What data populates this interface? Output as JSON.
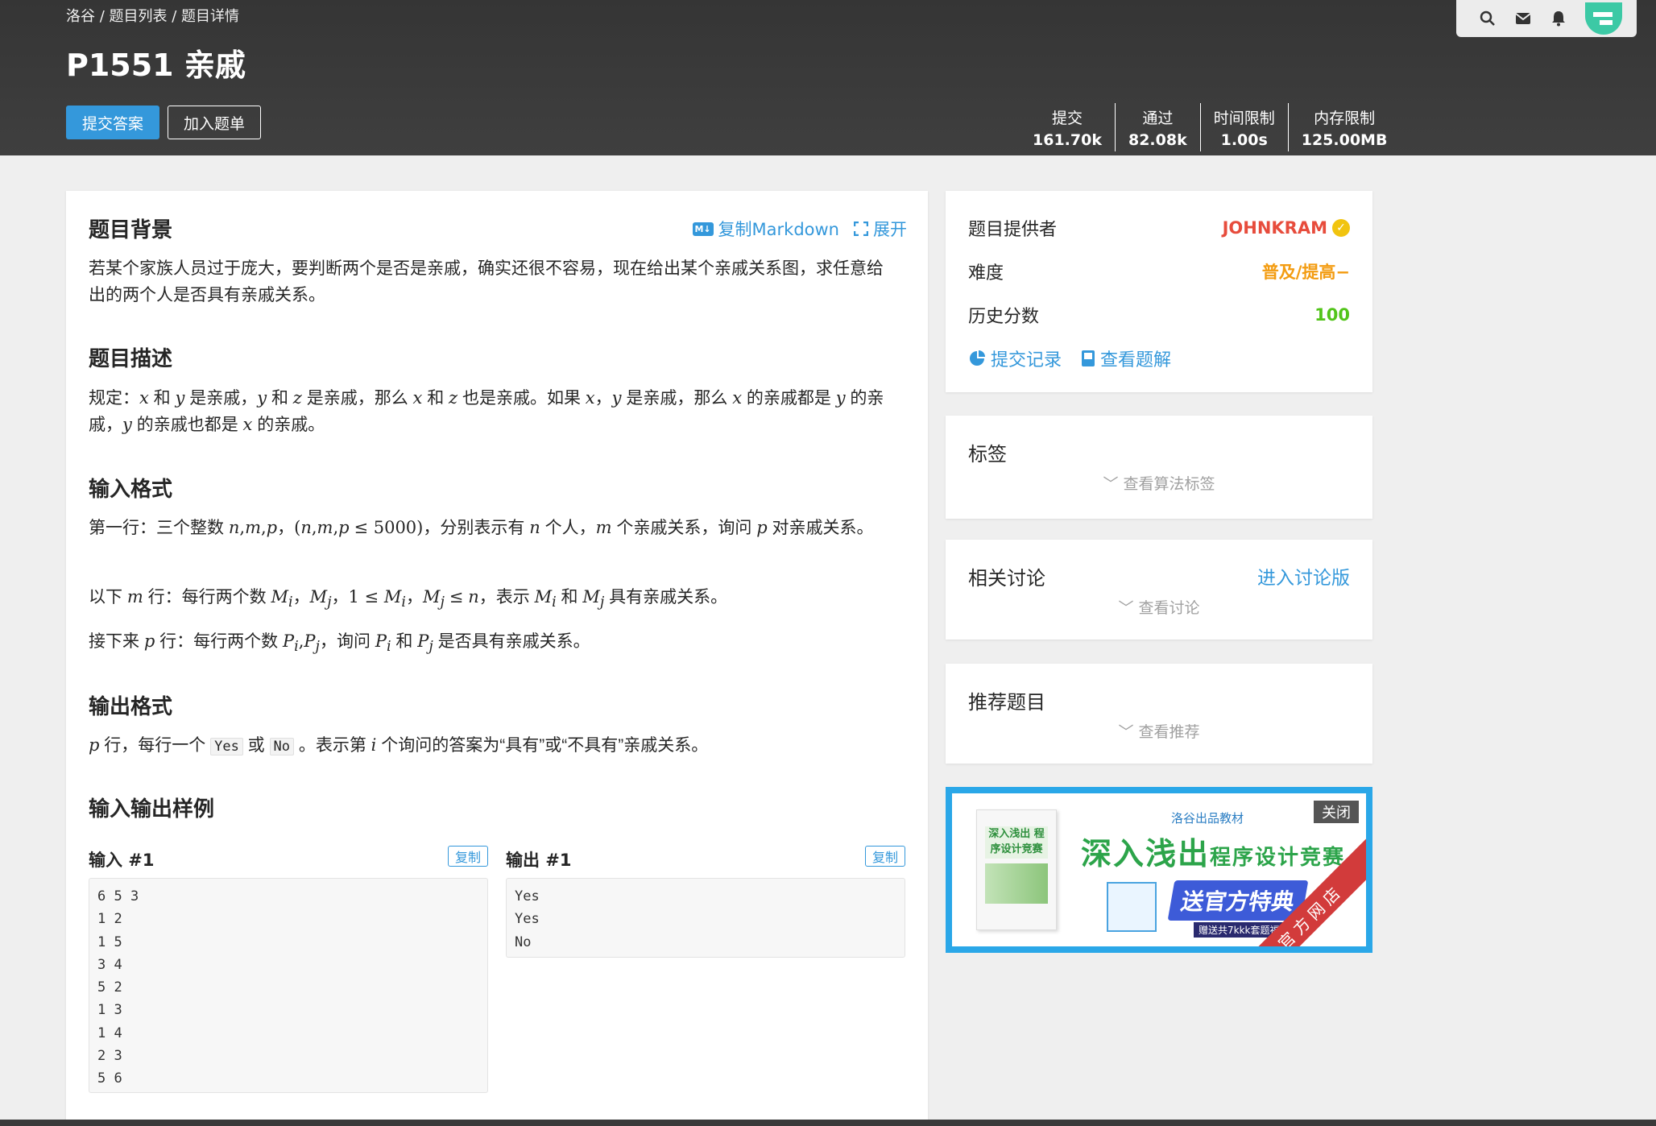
{
  "header": {
    "breadcrumb": [
      "洛谷",
      "题目列表",
      "题目详情"
    ],
    "title": "P1551 亲戚",
    "submit_label": "提交答案",
    "add_label": "加入题单",
    "stats": [
      {
        "label": "提交",
        "value": "161.70k"
      },
      {
        "label": "通过",
        "value": "82.08k"
      },
      {
        "label": "时间限制",
        "value": "1.00s"
      },
      {
        "label": "内存限制",
        "value": "125.00MB"
      }
    ],
    "topbar_icons": [
      "search-icon",
      "mail-icon",
      "bell-icon",
      "avatar"
    ]
  },
  "problem": {
    "actions": {
      "copy_markdown": "复制Markdown",
      "expand": "展开",
      "md_badge": "M↓"
    },
    "background_title": "题目背景",
    "background_text": "若某个家族人员过于庞大，要判断两个是否是亲戚，确实还很不容易，现在给出某个亲戚关系图，求任意给出的两个人是否具有亲戚关系。",
    "description_title": "题目描述",
    "input_title": "输入格式",
    "output_title": "输出格式",
    "samples_title": "输入输出样例",
    "output_codes": {
      "yes": "Yes",
      "no": "No"
    },
    "sample_input_label": "输入 #1",
    "sample_output_label": "输出 #1",
    "copy_label": "复制",
    "sample_input": "6 5 3\n1 2\n1 5\n3 4\n5 2\n1 3\n1 4\n2 3\n5 6",
    "sample_output": "Yes\nYes\nNo"
  },
  "info": {
    "provider_label": "题目提供者",
    "provider_name": "JOHNKRAM",
    "difficulty_label": "难度",
    "difficulty_value": "普及/提高−",
    "score_label": "历史分数",
    "score_value": "100",
    "records_label": "提交记录",
    "solutions_label": "查看题解"
  },
  "tags": {
    "title": "标签",
    "sub": "查看算法标签"
  },
  "discuss": {
    "title": "相关讨论",
    "link": "进入讨论版",
    "sub": "查看讨论"
  },
  "recommend": {
    "title": "推荐题目",
    "sub": "查看推荐"
  },
  "ad": {
    "close": "关闭",
    "brand": "洛谷出品教材",
    "headline_big": "深入浅出",
    "headline_small": "程序设计竞赛",
    "banner": "送官方特典",
    "banner_sub": "赠送共7kkk套题福利",
    "ribbon": "官方网店",
    "book_title": "深入浅出 程序设计竞赛"
  },
  "colors": {
    "accent": "#3498db",
    "provider": "#e74c3c",
    "difficulty": "#f39c11",
    "score": "#52c41a",
    "header_bg": "#3a3a3a"
  }
}
